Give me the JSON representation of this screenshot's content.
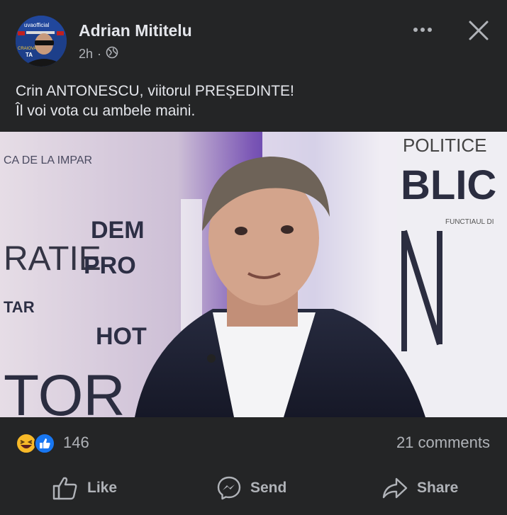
{
  "post": {
    "author": "Adrian Mititelu",
    "time": "2h",
    "separator": "·",
    "text_line1": "Crin ANTONESCU, viitorul PREȘEDINTE!",
    "text_line2": "Îl voi vota cu ambele maini.",
    "avatar_overlay_text": "uvaofficial",
    "avatar_lower_text": "CRAIOVA",
    "avatar_badge_text": "TA"
  },
  "photo": {
    "bg_text_ratie": "RATIE",
    "bg_text_dem": "DEM",
    "bg_text_pro": "PRO",
    "bg_text_hot": "HOT",
    "bg_text_tar": "TAR",
    "bg_text_tor": "TOR",
    "bg_text_blic": "BLIC",
    "bg_text_politice": "POLITICE",
    "bg_text_top_left": "CA DE LA IMPAR",
    "bg_text_small_right": "FUNCTIAUL DI"
  },
  "engagement": {
    "reaction_count": "146",
    "comments": "21 comments"
  },
  "actions": {
    "like": "Like",
    "send": "Send",
    "share": "Share"
  },
  "colors": {
    "background": "#242526",
    "text_primary": "#e4e6eb",
    "text_secondary": "#b0b3b8",
    "like_blue": "#1877f2",
    "haha_yellow": "#f7b928"
  },
  "icons": {
    "more": "more-dots-icon",
    "close": "close-icon",
    "privacy": "globe-icon",
    "like": "thumbs-up-icon",
    "send": "messenger-icon",
    "share": "share-arrow-icon"
  }
}
